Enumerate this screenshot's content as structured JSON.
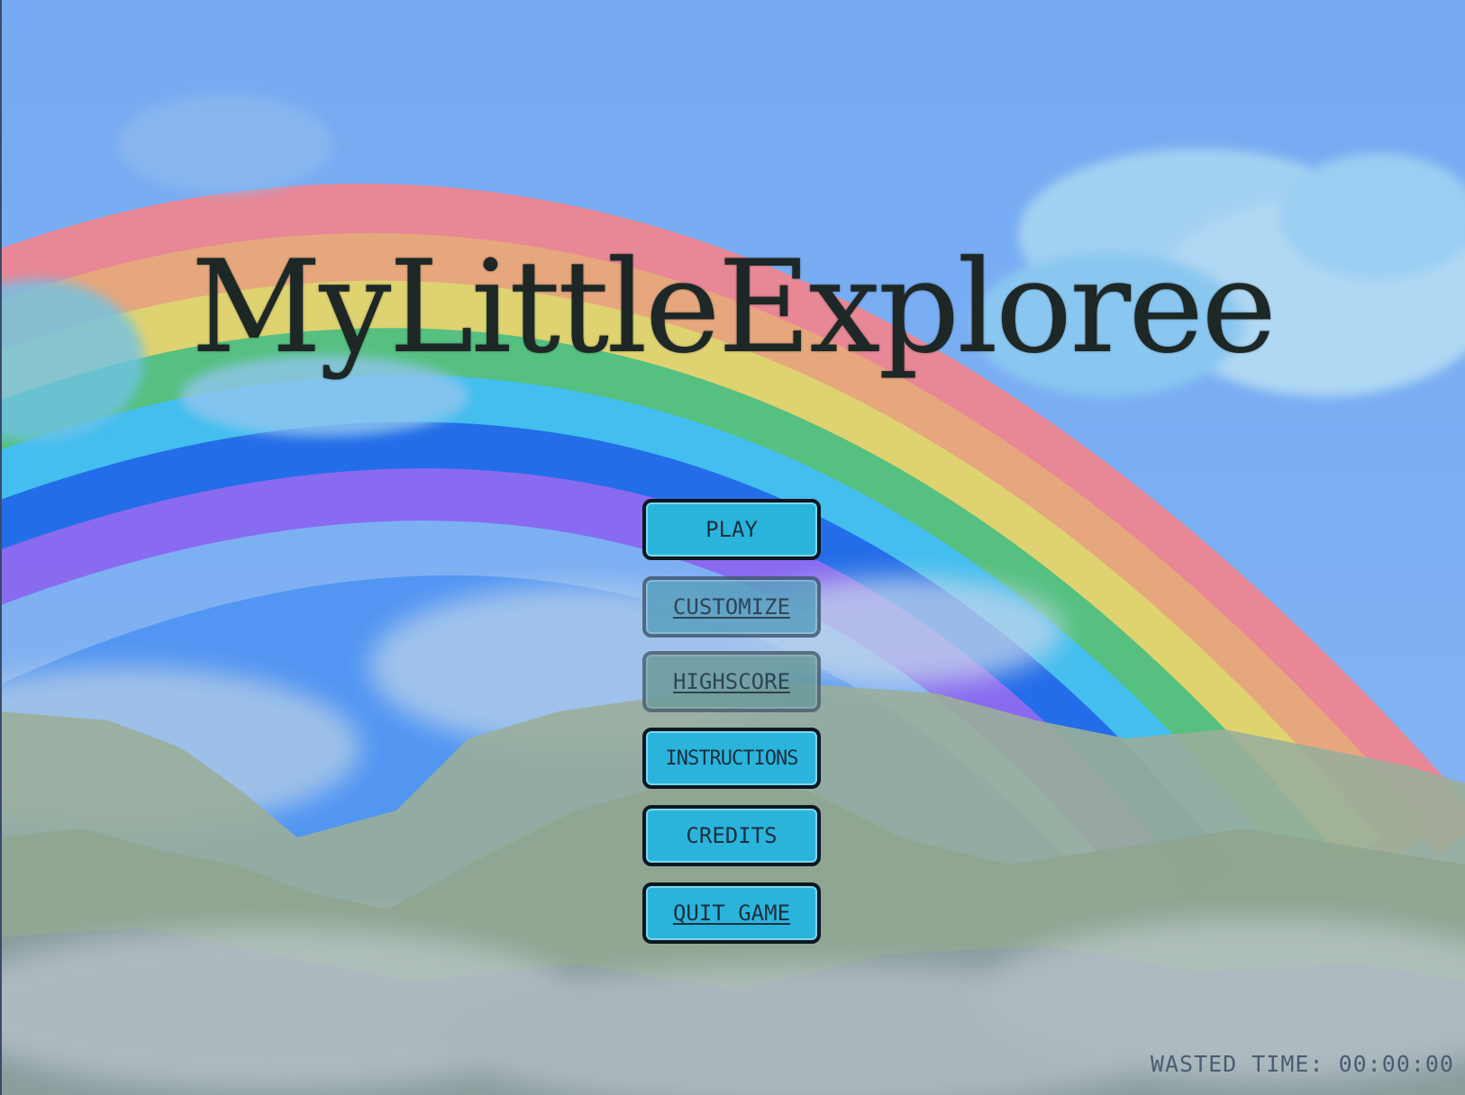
{
  "game": {
    "title": "MyLittleExploree"
  },
  "menu": {
    "items": [
      {
        "id": "play",
        "label": "PLAY"
      },
      {
        "id": "customize",
        "label": "CUSTOMIZE"
      },
      {
        "id": "highscore",
        "label": "HIGHSCORE"
      },
      {
        "id": "instructions",
        "label": "INSTRUCTIONS"
      },
      {
        "id": "credits",
        "label": "CREDITS"
      },
      {
        "id": "quit",
        "label": "QUIT GAME"
      }
    ]
  },
  "status": {
    "wasted_time_label": "WASTED TIME:",
    "wasted_time_value": "00:00:00"
  },
  "colors": {
    "button_fill": "#2ab4dc",
    "button_border": "#0d1720",
    "title_text": "#1d2726",
    "sky": "#7fb2f4"
  }
}
